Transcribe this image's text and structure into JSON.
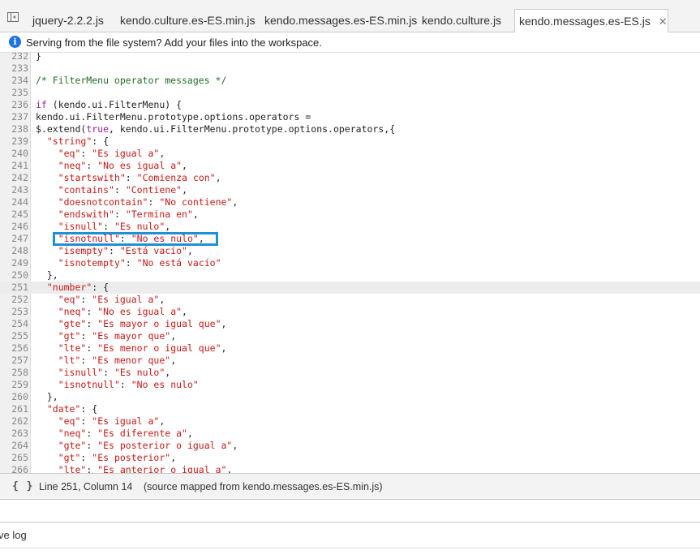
{
  "tabs": [
    {
      "label": "jquery-2.2.2.js",
      "active": false
    },
    {
      "label": "kendo.culture.es-ES.min.js",
      "active": false
    },
    {
      "label": "kendo.messages.es-ES.min.js",
      "active": false
    },
    {
      "label": "kendo.culture.js",
      "active": false
    },
    {
      "label": "kendo.messages.es-ES.js",
      "active": true
    }
  ],
  "tab_close_glyph": "✕",
  "info_bar": {
    "icon": "info-icon",
    "text": "Serving from the file system? Add your files into the workspace."
  },
  "editor": {
    "highlight_color": "#1e90d6",
    "current_line": 251,
    "lines": [
      {
        "n": "232",
        "tokens": [
          {
            "t": "}",
            "c": "p"
          }
        ]
      },
      {
        "n": "233",
        "tokens": []
      },
      {
        "n": "234",
        "tokens": [
          {
            "t": "/* FilterMenu operator messages */",
            "c": "c"
          }
        ]
      },
      {
        "n": "235",
        "tokens": []
      },
      {
        "n": "236",
        "tokens": [
          {
            "t": "if",
            "c": "k"
          },
          {
            "t": " (kendo.ui.FilterMenu) {",
            "c": "p"
          }
        ]
      },
      {
        "n": "237",
        "tokens": [
          {
            "t": "kendo.ui.FilterMenu.prototype.options.operators =",
            "c": "p"
          }
        ]
      },
      {
        "n": "238",
        "tokens": [
          {
            "t": "$.extend(",
            "c": "p"
          },
          {
            "t": "true",
            "c": "k"
          },
          {
            "t": ", kendo.ui.FilterMenu.prototype.options.operators,{",
            "c": "p"
          }
        ]
      },
      {
        "n": "239",
        "tokens": [
          {
            "t": "  ",
            "c": "p"
          },
          {
            "t": "\"string\"",
            "c": "s"
          },
          {
            "t": ": {",
            "c": "p"
          }
        ]
      },
      {
        "n": "240",
        "tokens": [
          {
            "t": "    ",
            "c": "p"
          },
          {
            "t": "\"eq\"",
            "c": "s"
          },
          {
            "t": ": ",
            "c": "p"
          },
          {
            "t": "\"Es igual a\"",
            "c": "s"
          },
          {
            "t": ",",
            "c": "p"
          }
        ]
      },
      {
        "n": "241",
        "tokens": [
          {
            "t": "    ",
            "c": "p"
          },
          {
            "t": "\"neq\"",
            "c": "s"
          },
          {
            "t": ": ",
            "c": "p"
          },
          {
            "t": "\"No es igual a\"",
            "c": "s"
          },
          {
            "t": ",",
            "c": "p"
          }
        ]
      },
      {
        "n": "242",
        "tokens": [
          {
            "t": "    ",
            "c": "p"
          },
          {
            "t": "\"startswith\"",
            "c": "s"
          },
          {
            "t": ": ",
            "c": "p"
          },
          {
            "t": "\"Comienza con\"",
            "c": "s"
          },
          {
            "t": ",",
            "c": "p"
          }
        ]
      },
      {
        "n": "243",
        "tokens": [
          {
            "t": "    ",
            "c": "p"
          },
          {
            "t": "\"contains\"",
            "c": "s"
          },
          {
            "t": ": ",
            "c": "p"
          },
          {
            "t": "\"Contiene\"",
            "c": "s"
          },
          {
            "t": ",",
            "c": "p"
          }
        ]
      },
      {
        "n": "244",
        "tokens": [
          {
            "t": "    ",
            "c": "p"
          },
          {
            "t": "\"doesnotcontain\"",
            "c": "s"
          },
          {
            "t": ": ",
            "c": "p"
          },
          {
            "t": "\"No contiene\"",
            "c": "s"
          },
          {
            "t": ",",
            "c": "p"
          }
        ]
      },
      {
        "n": "245",
        "tokens": [
          {
            "t": "    ",
            "c": "p"
          },
          {
            "t": "\"endswith\"",
            "c": "s"
          },
          {
            "t": ": ",
            "c": "p"
          },
          {
            "t": "\"Termina en\"",
            "c": "s"
          },
          {
            "t": ",",
            "c": "p"
          }
        ]
      },
      {
        "n": "246",
        "tokens": [
          {
            "t": "    ",
            "c": "p"
          },
          {
            "t": "\"isnull\"",
            "c": "s"
          },
          {
            "t": ": ",
            "c": "p"
          },
          {
            "t": "\"Es nulo\"",
            "c": "s"
          },
          {
            "t": ",",
            "c": "p"
          }
        ]
      },
      {
        "n": "247",
        "tokens": [
          {
            "t": "    ",
            "c": "p"
          },
          {
            "t": "\"isnotnull\"",
            "c": "s"
          },
          {
            "t": ": ",
            "c": "p"
          },
          {
            "t": "\"No es nulo\"",
            "c": "s"
          },
          {
            "t": ",",
            "c": "p"
          }
        ]
      },
      {
        "n": "248",
        "tokens": [
          {
            "t": "    ",
            "c": "p"
          },
          {
            "t": "\"isempty\"",
            "c": "s"
          },
          {
            "t": ": ",
            "c": "p"
          },
          {
            "t": "\"Está vacío\"",
            "c": "s"
          },
          {
            "t": ",",
            "c": "p"
          }
        ]
      },
      {
        "n": "249",
        "tokens": [
          {
            "t": "    ",
            "c": "p"
          },
          {
            "t": "\"isnotempty\"",
            "c": "s"
          },
          {
            "t": ": ",
            "c": "p"
          },
          {
            "t": "\"No está vacío\"",
            "c": "s"
          }
        ]
      },
      {
        "n": "250",
        "tokens": [
          {
            "t": "  },",
            "c": "p"
          }
        ]
      },
      {
        "n": "251",
        "tokens": [
          {
            "t": "  ",
            "c": "p"
          },
          {
            "t": "\"number\"",
            "c": "s"
          },
          {
            "t": ": {",
            "c": "p"
          }
        ]
      },
      {
        "n": "252",
        "tokens": [
          {
            "t": "    ",
            "c": "p"
          },
          {
            "t": "\"eq\"",
            "c": "s"
          },
          {
            "t": ": ",
            "c": "p"
          },
          {
            "t": "\"Es igual a\"",
            "c": "s"
          },
          {
            "t": ",",
            "c": "p"
          }
        ]
      },
      {
        "n": "253",
        "tokens": [
          {
            "t": "    ",
            "c": "p"
          },
          {
            "t": "\"neq\"",
            "c": "s"
          },
          {
            "t": ": ",
            "c": "p"
          },
          {
            "t": "\"No es igual a\"",
            "c": "s"
          },
          {
            "t": ",",
            "c": "p"
          }
        ]
      },
      {
        "n": "254",
        "tokens": [
          {
            "t": "    ",
            "c": "p"
          },
          {
            "t": "\"gte\"",
            "c": "s"
          },
          {
            "t": ": ",
            "c": "p"
          },
          {
            "t": "\"Es mayor o igual que\"",
            "c": "s"
          },
          {
            "t": ",",
            "c": "p"
          }
        ]
      },
      {
        "n": "255",
        "tokens": [
          {
            "t": "    ",
            "c": "p"
          },
          {
            "t": "\"gt\"",
            "c": "s"
          },
          {
            "t": ": ",
            "c": "p"
          },
          {
            "t": "\"Es mayor que\"",
            "c": "s"
          },
          {
            "t": ",",
            "c": "p"
          }
        ]
      },
      {
        "n": "256",
        "tokens": [
          {
            "t": "    ",
            "c": "p"
          },
          {
            "t": "\"lte\"",
            "c": "s"
          },
          {
            "t": ": ",
            "c": "p"
          },
          {
            "t": "\"Es menor o igual que\"",
            "c": "s"
          },
          {
            "t": ",",
            "c": "p"
          }
        ]
      },
      {
        "n": "257",
        "tokens": [
          {
            "t": "    ",
            "c": "p"
          },
          {
            "t": "\"lt\"",
            "c": "s"
          },
          {
            "t": ": ",
            "c": "p"
          },
          {
            "t": "\"Es menor que\"",
            "c": "s"
          },
          {
            "t": ",",
            "c": "p"
          }
        ]
      },
      {
        "n": "258",
        "tokens": [
          {
            "t": "    ",
            "c": "p"
          },
          {
            "t": "\"isnull\"",
            "c": "s"
          },
          {
            "t": ": ",
            "c": "p"
          },
          {
            "t": "\"Es nulo\"",
            "c": "s"
          },
          {
            "t": ",",
            "c": "p"
          }
        ]
      },
      {
        "n": "259",
        "tokens": [
          {
            "t": "    ",
            "c": "p"
          },
          {
            "t": "\"isnotnull\"",
            "c": "s"
          },
          {
            "t": ": ",
            "c": "p"
          },
          {
            "t": "\"No es nulo\"",
            "c": "s"
          }
        ]
      },
      {
        "n": "260",
        "tokens": [
          {
            "t": "  },",
            "c": "p"
          }
        ]
      },
      {
        "n": "261",
        "tokens": [
          {
            "t": "  ",
            "c": "p"
          },
          {
            "t": "\"date\"",
            "c": "s"
          },
          {
            "t": ": {",
            "c": "p"
          }
        ]
      },
      {
        "n": "262",
        "tokens": [
          {
            "t": "    ",
            "c": "p"
          },
          {
            "t": "\"eq\"",
            "c": "s"
          },
          {
            "t": ": ",
            "c": "p"
          },
          {
            "t": "\"Es igual a\"",
            "c": "s"
          },
          {
            "t": ",",
            "c": "p"
          }
        ]
      },
      {
        "n": "263",
        "tokens": [
          {
            "t": "    ",
            "c": "p"
          },
          {
            "t": "\"neq\"",
            "c": "s"
          },
          {
            "t": ": ",
            "c": "p"
          },
          {
            "t": "\"Es diferente a\"",
            "c": "s"
          },
          {
            "t": ",",
            "c": "p"
          }
        ]
      },
      {
        "n": "264",
        "tokens": [
          {
            "t": "    ",
            "c": "p"
          },
          {
            "t": "\"gte\"",
            "c": "s"
          },
          {
            "t": ": ",
            "c": "p"
          },
          {
            "t": "\"Es posterior o igual a\"",
            "c": "s"
          },
          {
            "t": ",",
            "c": "p"
          }
        ]
      },
      {
        "n": "265",
        "tokens": [
          {
            "t": "    ",
            "c": "p"
          },
          {
            "t": "\"gt\"",
            "c": "s"
          },
          {
            "t": ": ",
            "c": "p"
          },
          {
            "t": "\"Es posterior\"",
            "c": "s"
          },
          {
            "t": ",",
            "c": "p"
          }
        ]
      },
      {
        "n": "266",
        "tokens": [
          {
            "t": "    ",
            "c": "p"
          },
          {
            "t": "\"lte\"",
            "c": "s"
          },
          {
            "t": ": ",
            "c": "p"
          },
          {
            "t": "\"Es anterior o igual a\"",
            "c": "s"
          },
          {
            "t": ",",
            "c": "p"
          }
        ]
      }
    ]
  },
  "status_bar": {
    "pretty_print_icon": "{ }",
    "cursor_position": "Line 251, Column 14",
    "source_map": "(source mapped from kendo.messages.es-ES.min.js)"
  },
  "console": {
    "preserve_log_label": "ve log"
  }
}
